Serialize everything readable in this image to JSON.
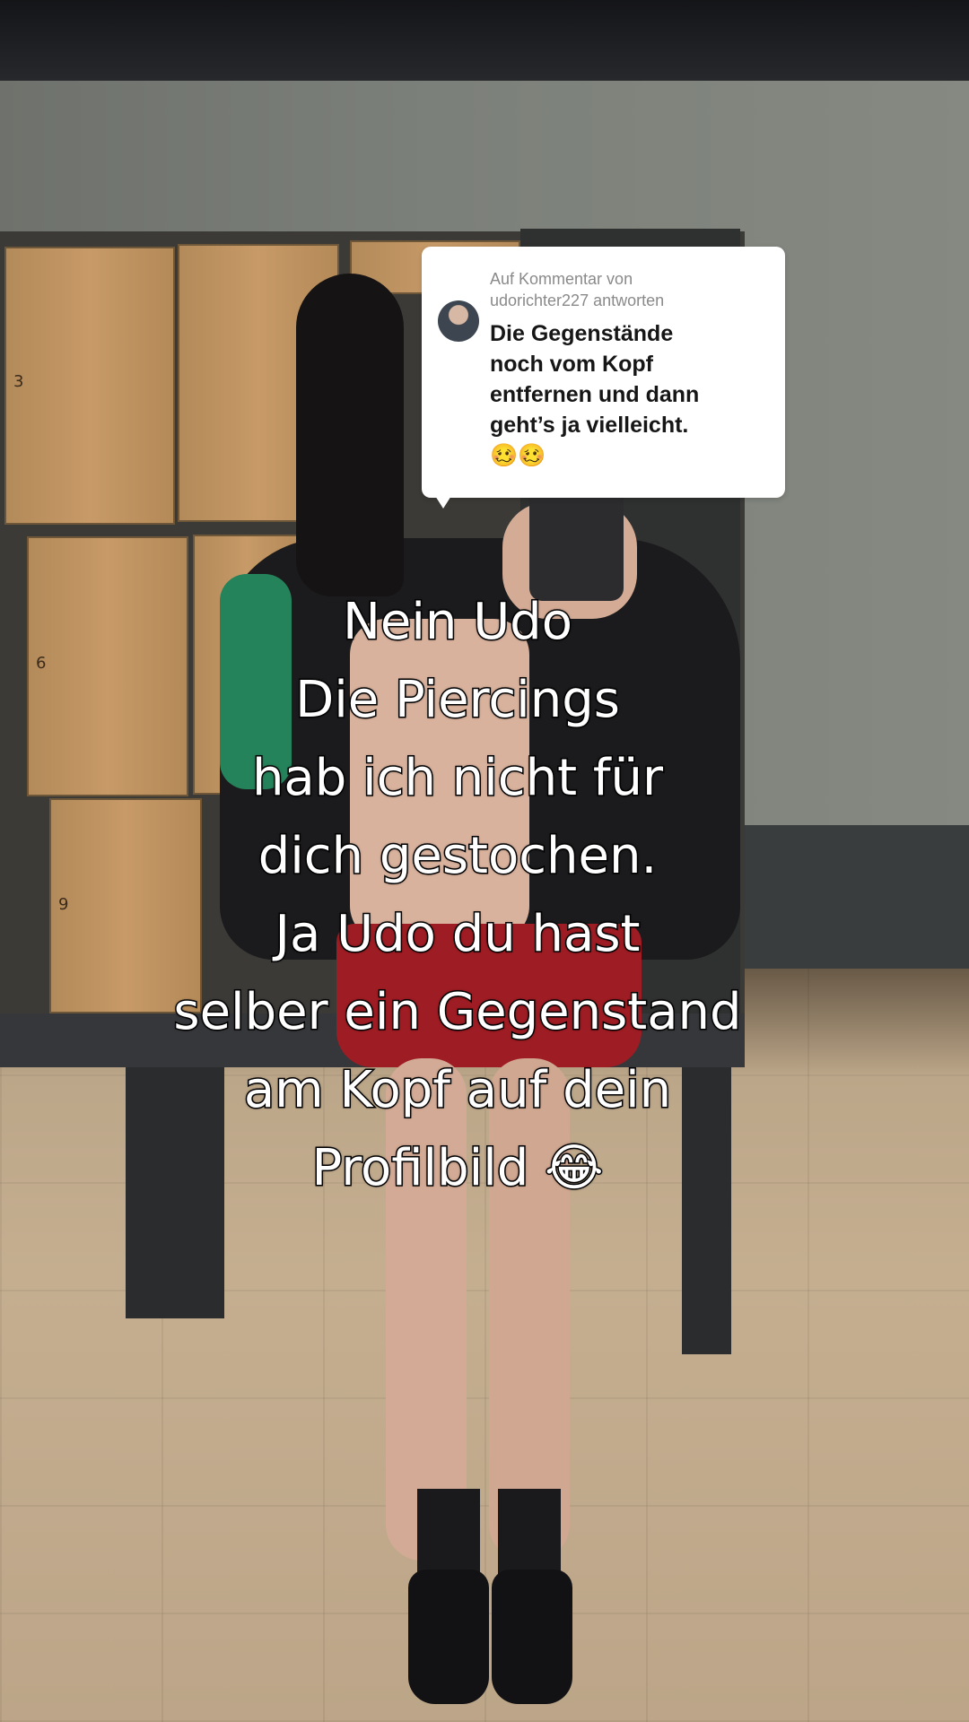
{
  "reply_sticker": {
    "header_line1": "Auf Kommentar von",
    "header_line2": "udorichter227 antworten",
    "comment_lines": [
      "Die Gegenstände",
      "noch vom Kopf",
      "entfernen und dann",
      "geht’s ja vielleicht.",
      "🥴🥴"
    ]
  },
  "caption": {
    "lines": [
      "Nein Udo",
      "Die Piercings",
      "hab ich nicht für",
      "dich gestochen.",
      "Ja Udo du hast",
      "selber ein Gegenstand",
      "am Kopf auf dein",
      "Profilbild 😂"
    ]
  },
  "locker_numbers": [
    "3",
    "6",
    "9"
  ],
  "colors": {
    "caption_text": "#ffffff",
    "caption_outline": "#000000",
    "bubble_bg": "#ffffff",
    "bubble_header": "#8a8a8a",
    "bubble_text": "#161616"
  }
}
